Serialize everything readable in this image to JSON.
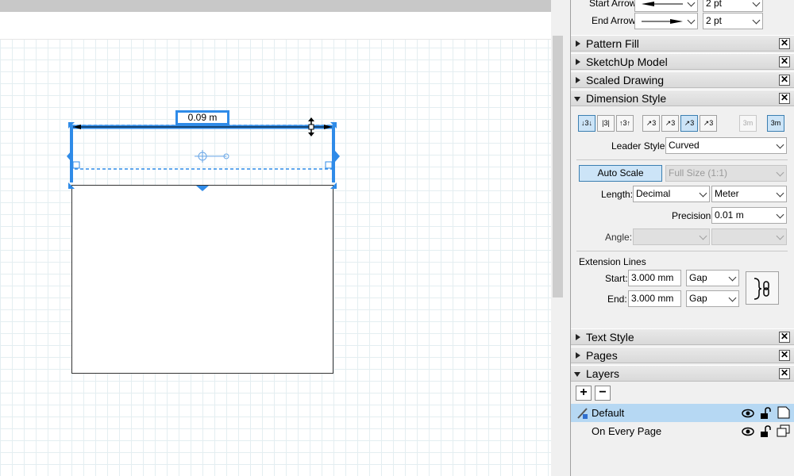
{
  "canvas": {
    "dimension_label": "0.09 m"
  },
  "arrows": {
    "start_label": "Start Arrow:",
    "end_label": "End Arrow:",
    "start_size": "2 pt",
    "end_size": "2 pt"
  },
  "panels": {
    "pattern_fill": "Pattern Fill",
    "sketchup_model": "SketchUp Model",
    "scaled_drawing": "Scaled Drawing",
    "dimension_style": "Dimension Style",
    "text_style": "Text Style",
    "pages": "Pages",
    "layers": "Layers"
  },
  "dimension_style": {
    "alignment_icons": [
      "↓3↓",
      "|3|",
      "↑3↑"
    ],
    "rotation_icons": [
      "↗3",
      "↗3",
      "↗3",
      "↗3"
    ],
    "extra_icons": [
      "3m",
      "3m"
    ],
    "leader_style_label": "Leader Style:",
    "leader_style_value": "Curved",
    "auto_scale_label": "Auto Scale",
    "scale_value": "Full Size (1:1)",
    "length_label": "Length:",
    "length_format": "Decimal",
    "length_unit": "Meter",
    "precision_label": "Precision:",
    "precision_value": "0.01 m",
    "angle_label": "Angle:",
    "extension_lines_label": "Extension Lines",
    "start_label": "Start:",
    "start_value": "3.000 mm",
    "start_mode": "Gap",
    "end_label": "End:",
    "end_value": "3.000 mm",
    "end_mode": "Gap"
  },
  "layers": {
    "add": "+",
    "remove": "−",
    "items": [
      {
        "name": "Default",
        "selected": true
      },
      {
        "name": "On Every Page",
        "selected": false
      }
    ]
  },
  "close_glyph": "✕"
}
